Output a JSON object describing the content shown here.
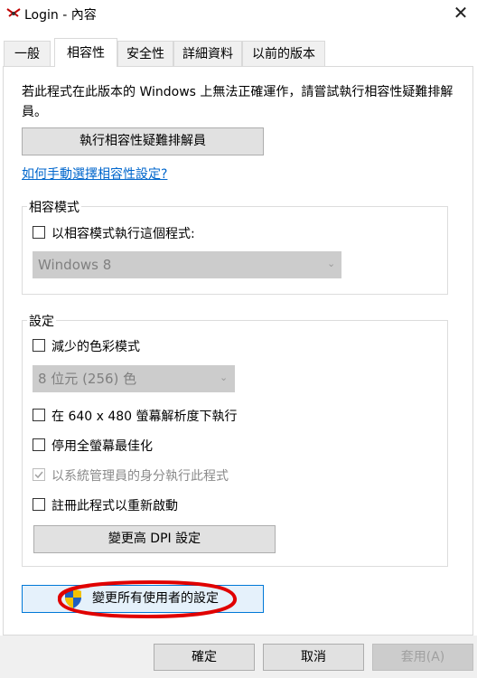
{
  "window": {
    "title": "Login - 內容",
    "close_glyph": "✕"
  },
  "tabs": [
    {
      "label": "一般",
      "active": false
    },
    {
      "label": "相容性",
      "active": true
    },
    {
      "label": "安全性",
      "active": false
    },
    {
      "label": "詳細資料",
      "active": false
    },
    {
      "label": "以前的版本",
      "active": false
    }
  ],
  "compat_tab": {
    "intro": "若此程式在此版本的 Windows 上無法正確運作，請嘗試執行相容性疑難排解員。",
    "troubleshoot_button": "執行相容性疑難排解員",
    "manual_link": "如何手動選擇相容性設定?",
    "compat_mode": {
      "group_label": "相容模式",
      "checkbox_label": "以相容模式執行這個程式:",
      "checked": false,
      "os_select_value": "Windows 8"
    },
    "settings": {
      "group_label": "設定",
      "reduced_color": {
        "label": "減少的色彩模式",
        "checked": false
      },
      "color_select_value": "8 位元 (256) 色",
      "res_640": {
        "label": "在 640 x 480 螢幕解析度下執行",
        "checked": false
      },
      "disable_fullscreen": {
        "label": "停用全螢幕最佳化",
        "checked": false
      },
      "run_as_admin": {
        "label": "以系統管理員的身分執行此程式",
        "checked": true,
        "disabled": true
      },
      "register_restart": {
        "label": "註冊此程式以重新啟動",
        "checked": false
      },
      "dpi_button": "變更高 DPI 設定"
    },
    "all_users_button": "變更所有使用者的設定"
  },
  "footer": {
    "ok": "確定",
    "cancel": "取消",
    "apply": "套用(A)"
  },
  "colors": {
    "link": "#0066cc",
    "annotation": "#e00000",
    "shield_blue": "#1f5fbf",
    "shield_yellow": "#f2c200"
  },
  "icons": {
    "app": "app-icon",
    "uac": "uac-shield-icon",
    "close": "close-icon",
    "dropdown": "chevron-down-icon"
  }
}
